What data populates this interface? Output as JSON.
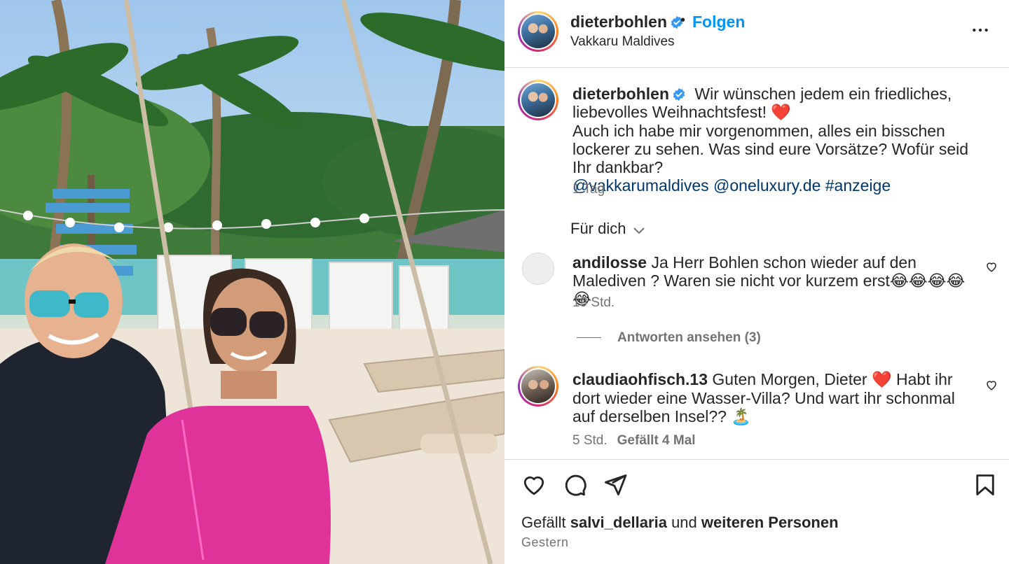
{
  "header": {
    "username": "dieterbohlen",
    "separator": "•",
    "follow_label": "Folgen",
    "location": "Vakkaru Maldives"
  },
  "caption": {
    "username": "dieterbohlen",
    "line1": "Wir wünschen jedem ein friedliches, liebevolles Weihnachtsfest!",
    "heart": "❤️",
    "line2": "Auch ich habe mir vorgenommen, alles ein bisschen lockerer zu sehen. Was sind eure Vorsätze? Wofür seid Ihr dankbar?",
    "mention1": "@vakkarumaldives",
    "mention2": "@oneluxury.de",
    "hashtag": "#anzeige",
    "time": "1 Tag"
  },
  "filter": {
    "label": "Für dich"
  },
  "comments": [
    {
      "username": "andilosse",
      "text": "Ja Herr Bohlen schon wieder auf den Malediven ? Waren sie nicht vor kurzem erst😂😂😂😂😂",
      "time": "19 Std.",
      "replies_label": "Antworten ansehen (3)"
    },
    {
      "username": "claudiaohfisch.13",
      "text_a": "Guten Morgen, Dieter",
      "heart": "❤️",
      "text_b": "Habt ihr dort wieder eine Wasser-Villa? Und wart ihr schonmal auf derselben Insel??",
      "emoji": "🏝️",
      "time": "5 Std.",
      "likes": "Gefällt 4 Mal"
    }
  ],
  "footer": {
    "likes_prefix": "Gefällt",
    "likes_user": "salvi_dellaria",
    "likes_and": "und",
    "likes_rest": "weiteren Personen",
    "date": "Gestern"
  },
  "icons": {
    "more": "more-horizontal-icon",
    "verified": "verified-badge-icon",
    "like": "heart-icon",
    "comment": "comment-icon",
    "share": "send-icon",
    "save": "bookmark-icon",
    "chevron": "chevron-down-icon"
  },
  "colors": {
    "link": "#0095f6",
    "mention": "#00376b",
    "verified": "#3897f0"
  }
}
